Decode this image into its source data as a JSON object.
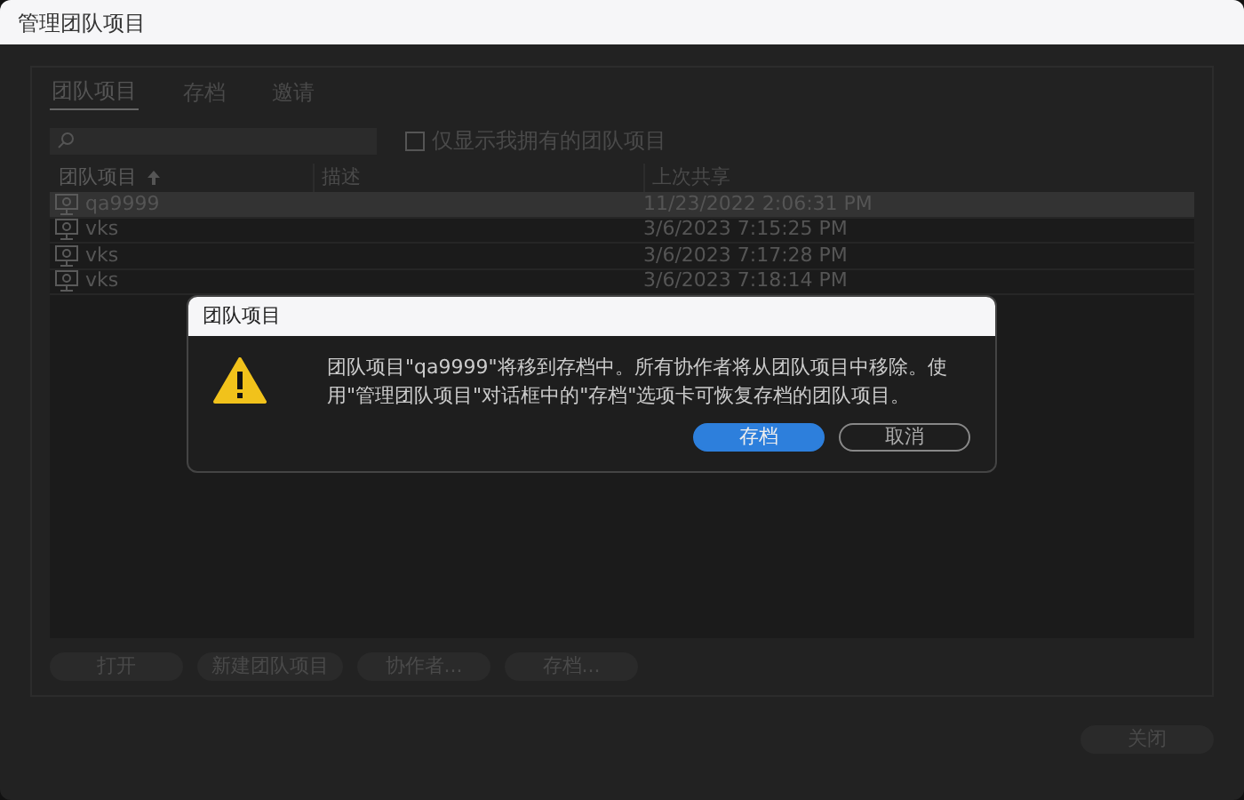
{
  "window": {
    "title": "管理团队项目"
  },
  "tabs": [
    {
      "label": "团队项目",
      "selected": true
    },
    {
      "label": "存档",
      "selected": false
    },
    {
      "label": "邀请",
      "selected": false
    }
  ],
  "filter": {
    "label": "仅显示我拥有的团队项目",
    "checked": false
  },
  "table": {
    "columns": [
      {
        "label": "团队项目",
        "sorted": true
      },
      {
        "label": "描述",
        "sorted": false
      },
      {
        "label": "上次共享",
        "sorted": false
      }
    ],
    "rows": [
      {
        "name": "qa9999",
        "shared": "11/23/2022 2:06:31 PM",
        "selected": true
      },
      {
        "name": "vks",
        "shared": "3/6/2023 7:15:25 PM",
        "selected": false
      },
      {
        "name": "vks",
        "shared": "3/6/2023 7:17:28 PM",
        "selected": false
      },
      {
        "name": "vks",
        "shared": "3/6/2023 7:18:14 PM",
        "selected": false
      }
    ]
  },
  "actions": [
    "打开",
    "新建团队项目",
    "协作者...",
    "存档..."
  ],
  "close_button": "关闭",
  "dialog": {
    "title": "团队项目",
    "message": "团队项目\"qa9999\"将移到存档中。所有协作者将从团队项目中移除。使用\"管理团队项目\"对话框中的\"存档\"选项卡可恢复存档的团队项目。",
    "buttons": [
      {
        "label": "存档",
        "primary": true
      },
      {
        "label": "取消",
        "primary": false
      }
    ]
  }
}
